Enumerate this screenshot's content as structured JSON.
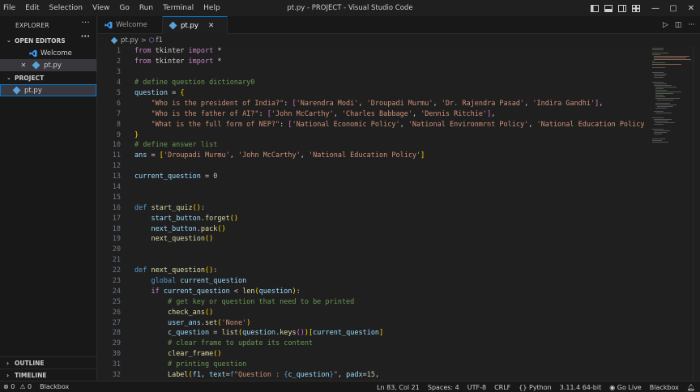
{
  "window": {
    "title": "pt.py - PROJECT - Visual Studio Code",
    "menu": [
      "File",
      "Edit",
      "Selection",
      "View",
      "Go",
      "Run",
      "Terminal",
      "Help"
    ],
    "controls": [
      "layout-sidebar-icon",
      "layout-panel-icon",
      "layout-secondary-icon",
      "layout-custom-icon"
    ],
    "minimize": "—",
    "maximize": "▢",
    "close": "✕"
  },
  "sidebar": {
    "title": "EXPLORER",
    "more": "···",
    "open_editors": {
      "label": "OPEN EDITORS",
      "items": [
        {
          "name": "Welcome",
          "icon": "vscode-icon"
        },
        {
          "name": "pt.py",
          "icon": "python-icon",
          "close": "✕"
        }
      ]
    },
    "project": {
      "label": "PROJECT",
      "items": [
        {
          "name": "pt.py",
          "icon": "python-icon"
        }
      ]
    },
    "outline": "OUTLINE",
    "timeline": "TIMELINE"
  },
  "tabs": [
    {
      "label": "Welcome",
      "icon": "vscode-icon",
      "active": false
    },
    {
      "label": "pt.py",
      "icon": "python-icon",
      "active": true,
      "close": "✕"
    }
  ],
  "tab_actions": {
    "run": "▷",
    "split": "◫",
    "more": "···"
  },
  "breadcrumb": {
    "file": "pt.py",
    "separator": ">",
    "symbol": "f1"
  },
  "code": {
    "lines": [
      "1",
      "2",
      "3",
      "4",
      "5",
      "6",
      "7",
      "8",
      "9",
      "10",
      "11",
      "12",
      "13",
      "14",
      "15",
      "16",
      "17",
      "18",
      "19",
      "20",
      "21",
      "22",
      "23",
      "24",
      "25",
      "26",
      "27",
      "28",
      "29",
      "30",
      "31",
      "32"
    ]
  },
  "status": {
    "errors": "⊗ 0",
    "warnings": "⚠ 0",
    "blackbox_left": "Blackbox",
    "position": "Ln 83, Col 21",
    "spaces": "Spaces: 4",
    "encoding": "UTF-8",
    "eol": "CRLF",
    "language": "{} Python",
    "interpreter": "3.11.4 64-bit",
    "golive": "Go Live",
    "blackbox_right": "Blackbox"
  }
}
